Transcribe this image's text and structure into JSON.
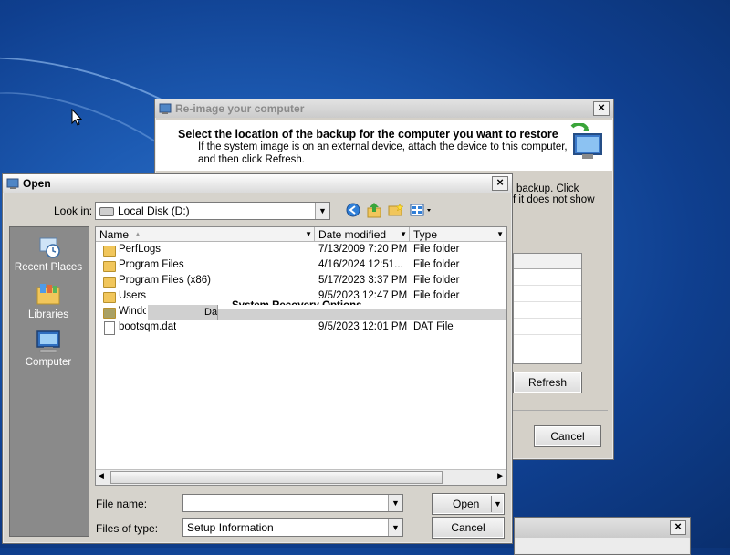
{
  "reimage": {
    "title": "Re-image your computer",
    "heading": "Select the location of the backup for the computer you want to restore",
    "desc_line1": "If the system image is on an external device, attach the device to this computer,",
    "desc_line2": "and then click Refresh.",
    "partial_line1": "backup. Click",
    "partial_line2": "f it does not show",
    "refresh_label": "Refresh",
    "cancel_label": "Cancel"
  },
  "open_dialog": {
    "title": "Open",
    "look_in_label": "Look in:",
    "look_in_value": "Local Disk (D:)",
    "places": [
      {
        "label": "Recent Places"
      },
      {
        "label": "Libraries"
      },
      {
        "label": "Computer"
      }
    ],
    "columns": {
      "name": "Name",
      "date": "Date modified",
      "type": "Type"
    },
    "files": [
      {
        "name": "PerfLogs",
        "date": "7/13/2009 7:20 PM",
        "type": "File folder"
      },
      {
        "name": "Program Files",
        "date": "4/16/2024 12:51...",
        "type": "File folder"
      },
      {
        "name": "Program Files (x86)",
        "date": "5/17/2023 3:37 PM",
        "type": "File folder"
      },
      {
        "name": "Users",
        "date": "9/5/2023 12:47 PM",
        "type": "File folder"
      },
      {
        "name": "Windc",
        "date": "",
        "type": ""
      },
      {
        "name": "bootsqm.dat",
        "date": "9/5/2023 12:01 PM",
        "type": "DAT File"
      }
    ],
    "overlay_da": "Da",
    "overlay_text": "System Recovery Options",
    "file_name_label": "File name:",
    "file_name_value": "",
    "files_of_type_label": "Files of type:",
    "files_of_type_value": "Setup Information",
    "open_label": "Open",
    "cancel_label": "Cancel"
  },
  "colors": {
    "desktop": "#1d5bb3",
    "dialog_bg": "#d4d0c8",
    "folder": "#f1c65b"
  }
}
